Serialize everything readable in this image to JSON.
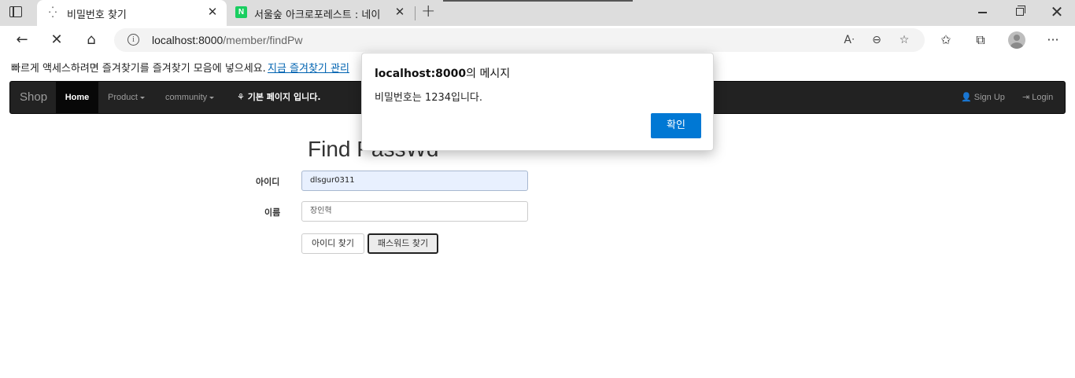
{
  "browser": {
    "tabs": [
      {
        "title": "비밀번호 찾기",
        "active": true
      },
      {
        "title": "서울숲 아크로포레스트 : 네이버",
        "active": false
      }
    ],
    "url_host": "localhost:8000",
    "url_path": "/member/findPw",
    "icons": {
      "tab_actions": "tab-actions-icon",
      "loading": "loading-icon",
      "close": "close-icon",
      "naver_favicon": "N",
      "new_tab": "plus-icon",
      "back": "back-arrow-icon",
      "stop": "stop-icon",
      "home": "home-icon",
      "info": "info-icon",
      "read_aloud": "read-aloud-icon",
      "zoom": "zoom-out-icon",
      "fav_add": "add-favorite-icon",
      "favorites": "favorites-icon",
      "collections": "collections-icon",
      "profile": "profile-icon",
      "more": "more-icon"
    },
    "favorites_bar": {
      "text": "빠르게 액세스하려면 즐겨찾기를 즐겨찾기 모음에 넣으세요.",
      "link": "지금 즐겨찾기 관리"
    }
  },
  "navbar": {
    "brand": "Shop",
    "items": [
      {
        "label": "Home",
        "active": true
      },
      {
        "label": "Product",
        "dropdown": true
      },
      {
        "label": "community",
        "dropdown": true
      }
    ],
    "notice": "기본 페이지 입니다.",
    "right": [
      {
        "label": "Sign Up",
        "icon": "user-icon"
      },
      {
        "label": "Login",
        "icon": "login-icon"
      }
    ]
  },
  "form": {
    "title": "Find PassWd",
    "id_label": "아이디",
    "id_value": "dlsgur0311",
    "name_label": "이름",
    "name_value": "장인혁",
    "find_id_button": "아이디 찾기",
    "find_pw_button": "패스워드 찾기"
  },
  "dialog": {
    "origin": "localhost:8000",
    "title_suffix": "의 메시지",
    "message": "비밀번호는 1234입니다.",
    "ok_button": "확인"
  },
  "colors": {
    "navbar_bg": "#222222",
    "accent": "#0078d4",
    "link": "#0063b1"
  }
}
